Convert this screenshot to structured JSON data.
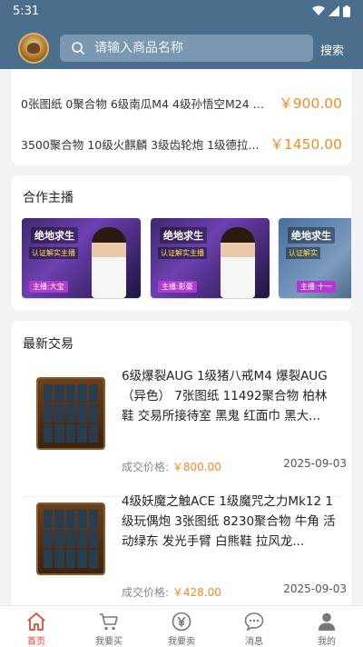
{
  "status": {
    "time": "5:31"
  },
  "search": {
    "placeholder": "请输入商品名称",
    "button": "搜索"
  },
  "top_items": [
    {
      "title": "0张图纸 0聚合物 6级南瓜M4 4级孙悟空M24 1...",
      "price": "￥900.00"
    },
    {
      "title": "3500聚合物 10级火麒麟 3级齿轮炮 1级德拉...",
      "price": "￥1450.00"
    }
  ],
  "partners": {
    "title": "合作主播",
    "items": [
      {
        "heading": "绝地求生",
        "sub": "认证解实主播",
        "name": "主播:大宝"
      },
      {
        "heading": "绝地求生",
        "sub": "认证解实主播",
        "name": "主播:影豪"
      },
      {
        "heading": "绝地求生",
        "sub": "认证解实",
        "name": "主播:十一"
      }
    ]
  },
  "trades": {
    "title": "最新交易",
    "price_label": "成交价格:",
    "items": [
      {
        "desc": "6级爆裂AUG 1级猪八戒M4 爆裂AUG（异色） 7张图纸 11492聚合物 柏林鞋 交易所接待室 黑鬼 红面巾 黑大...",
        "price": "￥800.00",
        "date": "2025-09-03"
      },
      {
        "desc": "4级妖魔之触ACE 1级魔咒之力Mk12 1级玩偶炮 3张图纸 8230聚合物 牛角 活动绿东 发光手臂 白熊鞋 拉风龙...",
        "price": "￥428.00",
        "date": "2025-09-03"
      }
    ]
  },
  "tabs": [
    {
      "label": "首页",
      "icon": "home-icon",
      "active": true
    },
    {
      "label": "我要买",
      "icon": "cart-icon",
      "active": false
    },
    {
      "label": "我要卖",
      "icon": "yen-icon",
      "active": false
    },
    {
      "label": "消息",
      "icon": "message-icon",
      "active": false
    },
    {
      "label": "我的",
      "icon": "user-icon",
      "active": false
    }
  ],
  "colors": {
    "header": "#4a6e8c",
    "price": "#f08a24",
    "active_tab": "#e0422f"
  }
}
